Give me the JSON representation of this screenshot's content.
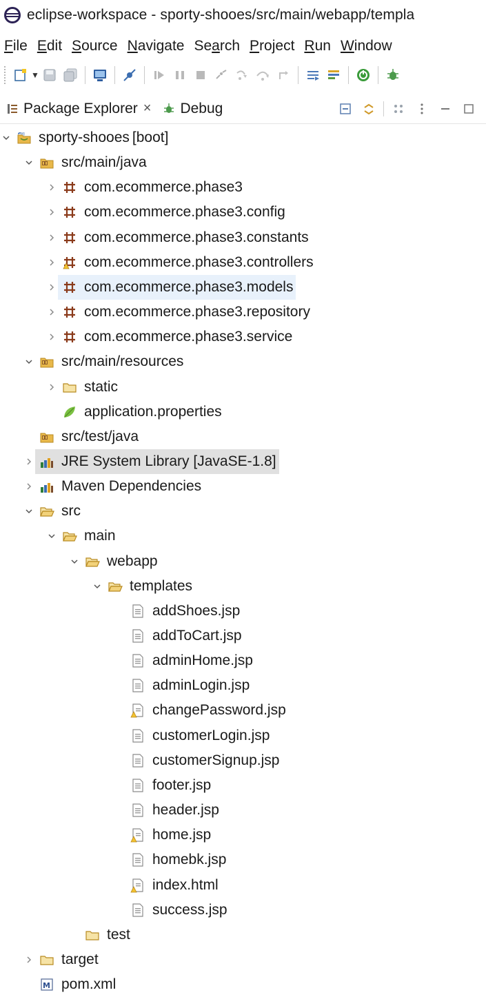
{
  "window": {
    "title": "eclipse-workspace - sporty-shooes/src/main/webapp/templa",
    "icon": "eclipse-icon"
  },
  "menu": [
    {
      "label": "File",
      "mnemonic": "F",
      "rest": "ile"
    },
    {
      "label": "Edit",
      "mnemonic": "E",
      "rest": "dit"
    },
    {
      "label": "Source",
      "mnemonic": "S",
      "rest": "ource"
    },
    {
      "label": "Navigate",
      "mnemonic": "N",
      "rest": "avigate"
    },
    {
      "label": "Search",
      "pre": "Se",
      "mnemonic": "a",
      "rest": "rch"
    },
    {
      "label": "Project",
      "mnemonic": "P",
      "rest": "roject"
    },
    {
      "label": "Run",
      "mnemonic": "R",
      "rest": "un"
    },
    {
      "label": "Window",
      "mnemonic": "W",
      "rest": "indow"
    }
  ],
  "toolbar": {
    "buttons": [
      "new-icon",
      "save-icon",
      "save-all-icon",
      "terminal-icon",
      "skip-breakpoints-icon",
      "resume-icon",
      "suspend-icon",
      "terminate-icon",
      "disconnect-icon",
      "step-into-icon",
      "step-over-icon",
      "step-return-icon",
      "use-step-filters-icon",
      "open-task-icon",
      "spring-boot-icon",
      "debug-icon"
    ]
  },
  "views": {
    "package_explorer": {
      "label": "Package Explorer",
      "close": "×"
    },
    "debug": {
      "label": "Debug"
    }
  },
  "tree": [
    {
      "label": "sporty-shooes",
      "decoration": " [boot]",
      "icon": "project-icon",
      "twisty": "expanded",
      "level": 0
    },
    {
      "label": "src/main/java",
      "icon": "source-folder-icon",
      "twisty": "expanded",
      "level": 1
    },
    {
      "label": "com.ecommerce.phase3",
      "icon": "package-icon",
      "twisty": "collapsed",
      "level": 2
    },
    {
      "label": "com.ecommerce.phase3.config",
      "icon": "package-icon",
      "twisty": "collapsed",
      "level": 2
    },
    {
      "label": "com.ecommerce.phase3.constants",
      "icon": "package-icon",
      "twisty": "collapsed",
      "level": 2
    },
    {
      "label": "com.ecommerce.phase3.controllers",
      "icon": "package-warning-icon",
      "twisty": "collapsed",
      "level": 2
    },
    {
      "label": "com.ecommerce.phase3.models",
      "icon": "package-icon",
      "twisty": "collapsed",
      "level": 2,
      "state": "hover"
    },
    {
      "label": "com.ecommerce.phase3.repository",
      "icon": "package-icon",
      "twisty": "collapsed",
      "level": 2
    },
    {
      "label": "com.ecommerce.phase3.service",
      "icon": "package-icon",
      "twisty": "collapsed",
      "level": 2
    },
    {
      "label": "src/main/resources",
      "icon": "source-folder-icon",
      "twisty": "expanded",
      "level": 1
    },
    {
      "label": "static",
      "icon": "folder-icon",
      "twisty": "collapsed",
      "level": 2
    },
    {
      "label": "application.properties",
      "icon": "spring-leaf-icon",
      "twisty": "none",
      "level": 2
    },
    {
      "label": "src/test/java",
      "icon": "source-folder-icon",
      "twisty": "none",
      "level": 1
    },
    {
      "label": "JRE System Library [JavaSE-1.8]",
      "icon": "library-icon",
      "twisty": "collapsed",
      "level": 1,
      "state": "selected"
    },
    {
      "label": "Maven Dependencies",
      "icon": "library-icon",
      "twisty": "collapsed",
      "level": 1
    },
    {
      "label": "src",
      "icon": "folder-open-icon",
      "twisty": "expanded",
      "level": 1
    },
    {
      "label": "main",
      "icon": "folder-open-icon",
      "twisty": "expanded",
      "level": 2
    },
    {
      "label": "webapp",
      "icon": "folder-open-icon",
      "twisty": "expanded",
      "level": 3
    },
    {
      "label": "templates",
      "icon": "folder-open-icon",
      "twisty": "expanded",
      "level": 4
    },
    {
      "label": "addShoes.jsp",
      "icon": "file-icon",
      "twisty": "none",
      "level": 5
    },
    {
      "label": "addToCart.jsp",
      "icon": "file-icon",
      "twisty": "none",
      "level": 5
    },
    {
      "label": "adminHome.jsp",
      "icon": "file-icon",
      "twisty": "none",
      "level": 5
    },
    {
      "label": "adminLogin.jsp",
      "icon": "file-icon",
      "twisty": "none",
      "level": 5
    },
    {
      "label": "changePassword.jsp",
      "icon": "file-warning-icon",
      "twisty": "none",
      "level": 5
    },
    {
      "label": "customerLogin.jsp",
      "icon": "file-icon",
      "twisty": "none",
      "level": 5
    },
    {
      "label": "customerSignup.jsp",
      "icon": "file-icon",
      "twisty": "none",
      "level": 5
    },
    {
      "label": "footer.jsp",
      "icon": "file-icon",
      "twisty": "none",
      "level": 5
    },
    {
      "label": "header.jsp",
      "icon": "file-icon",
      "twisty": "none",
      "level": 5
    },
    {
      "label": "home.jsp",
      "icon": "file-warning-icon",
      "twisty": "none",
      "level": 5
    },
    {
      "label": "homebk.jsp",
      "icon": "file-icon",
      "twisty": "none",
      "level": 5
    },
    {
      "label": "index.html",
      "icon": "file-warning-icon",
      "twisty": "none",
      "level": 5
    },
    {
      "label": "success.jsp",
      "icon": "file-icon",
      "twisty": "none",
      "level": 5
    },
    {
      "label": "test",
      "icon": "folder-icon",
      "twisty": "none",
      "level": 3
    },
    {
      "label": "target",
      "icon": "folder-icon",
      "twisty": "collapsed",
      "level": 1
    },
    {
      "label": "pom.xml",
      "icon": "maven-file-icon",
      "twisty": "none",
      "level": 1
    }
  ],
  "colors": {
    "hover_row": "#e8f1fb",
    "selected_row": "#e0e0e0",
    "decoration": "#9a7d3a",
    "folder": "#e8b84a",
    "package": "#8a5a2b"
  }
}
